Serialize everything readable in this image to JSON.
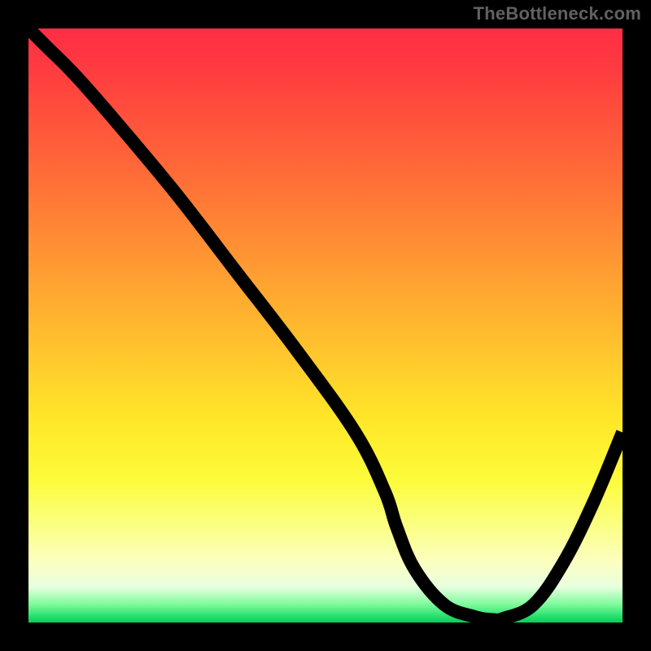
{
  "watermark": "TheBottleneck.com",
  "chart_data": {
    "type": "line",
    "title": "",
    "xlabel": "",
    "ylabel": "",
    "xlim": [
      0,
      100
    ],
    "ylim": [
      0,
      100
    ],
    "grid": false,
    "series": [
      {
        "name": "bottleneck-curve",
        "x": [
          0,
          3,
          8,
          15,
          25,
          35,
          45,
          55,
          60,
          62,
          65,
          70,
          75,
          78,
          80,
          85,
          90,
          95,
          100
        ],
        "y": [
          100,
          97,
          92,
          84,
          72,
          59,
          46,
          32,
          22,
          16,
          9,
          3,
          1,
          0.5,
          0.7,
          3,
          10,
          20,
          32
        ]
      }
    ],
    "highlight_segment": {
      "x_start": 62,
      "x_end": 80,
      "color": "#cf6a6a",
      "width": 10
    },
    "background_gradient": {
      "direction": "vertical",
      "stops": [
        {
          "pos": 0,
          "color": "#ff2d45"
        },
        {
          "pos": 50,
          "color": "#ffc42d"
        },
        {
          "pos": 80,
          "color": "#fcfb3a"
        },
        {
          "pos": 100,
          "color": "#0cc95b"
        }
      ]
    }
  }
}
